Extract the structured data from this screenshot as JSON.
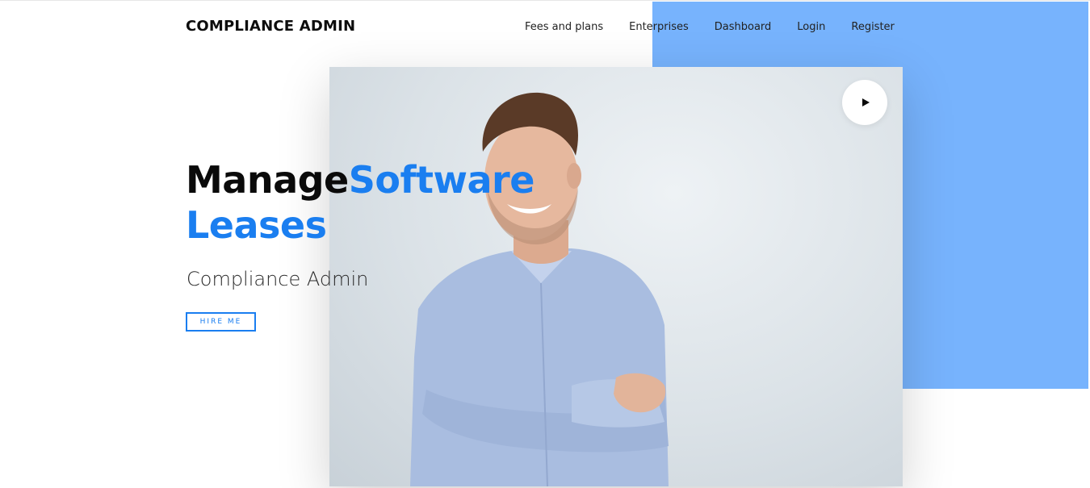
{
  "header": {
    "brand": "COMPLIANCE ADMIN",
    "nav": [
      {
        "label": "Fees and plans"
      },
      {
        "label": "Enterprises"
      },
      {
        "label": "Dashboard"
      },
      {
        "label": "Login"
      },
      {
        "label": "Register"
      }
    ]
  },
  "hero": {
    "title_word_1": "Manage",
    "title_word_2": "Software",
    "title_word_3": "Leases",
    "subtitle": "Compliance Admin",
    "cta_label": "HIRE ME",
    "play_icon": "play-icon",
    "photo": "smiling-man-in-light-blue-shirt-arms-crossed"
  },
  "colors": {
    "accent": "#1a7ef0",
    "backdrop_blue": "#77b3fd",
    "text_dark": "#0a0a0a"
  }
}
